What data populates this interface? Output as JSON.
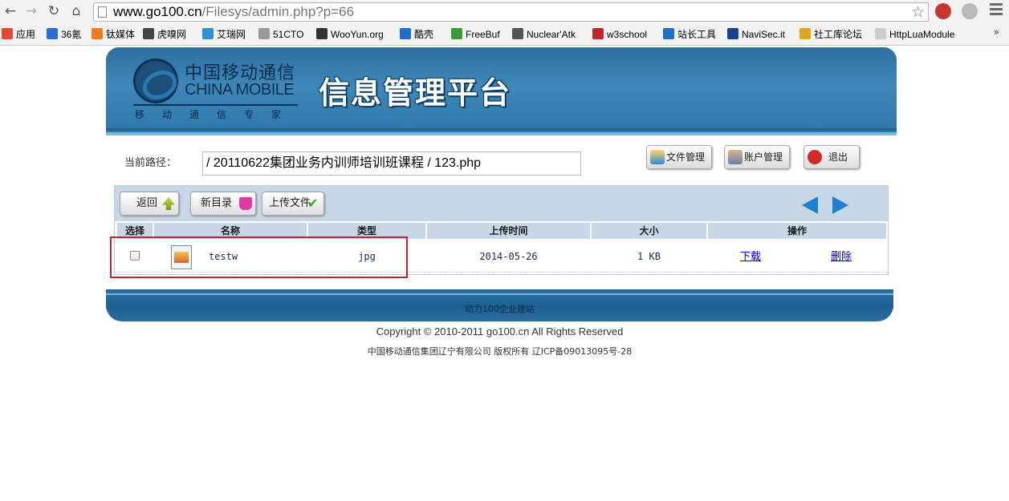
{
  "browser": {
    "url_host": "www.go100.cn",
    "url_rest": "/Filesys/admin.php?p=66",
    "bookmarks": [
      {
        "label": "应用",
        "color": "#e04a2f"
      },
      {
        "label": "36氪",
        "color": "#2a6fd6"
      },
      {
        "label": "钛媒体",
        "color": "#f07a1e"
      },
      {
        "label": "虎嗅网",
        "color": "#444444"
      },
      {
        "label": "艾瑞网",
        "color": "#2f8fd8"
      },
      {
        "label": "51CTO",
        "color": "#999999"
      },
      {
        "label": "WooYun.org",
        "color": "#333333"
      },
      {
        "label": "酷壳",
        "color": "#1e6ec8"
      },
      {
        "label": "FreeBuf",
        "color": "#3a9a3a"
      },
      {
        "label": "Nuclear'Atk",
        "color": "#555555"
      },
      {
        "label": "w3school",
        "color": "#c0282d"
      },
      {
        "label": "站长工具",
        "color": "#1e6ec8"
      },
      {
        "label": "NaviSec.it",
        "color": "#1b3f8f"
      },
      {
        "label": "社工库论坛",
        "color": "#e0a51e"
      },
      {
        "label": "HttpLuaModule",
        "color": "#cccccc"
      }
    ],
    "more_label": "»"
  },
  "header": {
    "logo_cn": "中国移动通信",
    "logo_en": "CHINA MOBILE",
    "logo_sub": "移动通信专家",
    "title": "信息管理平台"
  },
  "path": {
    "label": "当前路径：",
    "value": "/ 20110622集团业务内训师培训班课程 / 123.php"
  },
  "top_buttons": {
    "file_manage": "文件管理",
    "account_manage": "账户管理",
    "logout": "退出"
  },
  "toolbar": {
    "back": "返回",
    "new_dir": "新目录",
    "upload": "上传文件"
  },
  "table": {
    "headers": [
      "选择",
      "名称",
      "类型",
      "上传时间",
      "大小",
      "操作"
    ],
    "rows": [
      {
        "name": "testw",
        "type": "jpg",
        "time": "2014-05-26",
        "size": "1 KB",
        "download": "下载",
        "delete": "删除"
      }
    ]
  },
  "footer": {
    "bar_text": "动力100企业建站",
    "copyright": "Copyright © 2010-2011 go100.cn All Rights Reserved",
    "icp": "中国移动通信集团辽宁有限公司 版权所有 辽ICP备09013095号-28"
  },
  "colors": {
    "header_blue": "#2f6f9e",
    "table_header": "#c6d7e8",
    "highlight_red": "#c4252c",
    "link_blue": "#0000cc"
  }
}
